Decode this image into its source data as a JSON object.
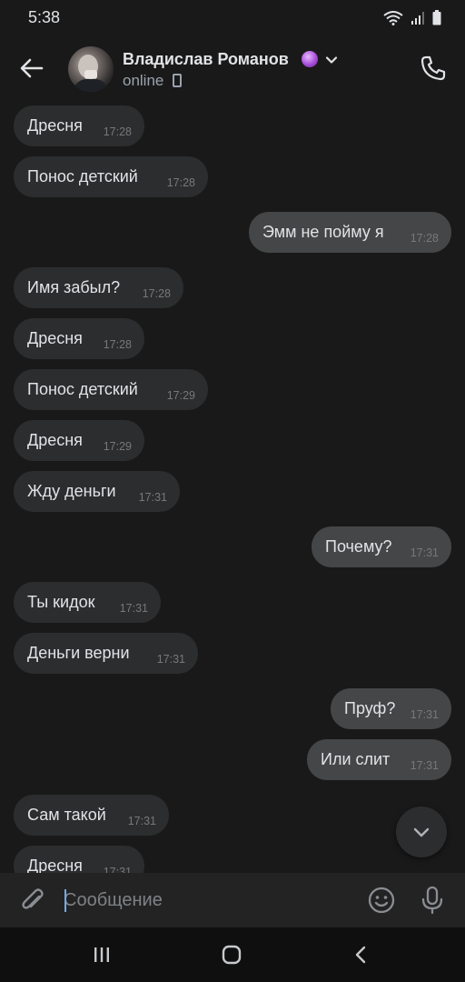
{
  "status_bar": {
    "time": "5:38"
  },
  "header": {
    "contact_name": "Владислав Романов",
    "status": "online"
  },
  "messages": [
    {
      "direction": "in",
      "text": "Дресня",
      "time": "17:28"
    },
    {
      "direction": "in",
      "text": "Понос детский",
      "time": "17:28"
    },
    {
      "direction": "out",
      "text": "Эмм не пойму я",
      "time": "17:28"
    },
    {
      "direction": "in",
      "text": "Имя забыл?",
      "time": "17:28"
    },
    {
      "direction": "in",
      "text": "Дресня",
      "time": "17:28"
    },
    {
      "direction": "in",
      "text": "Понос детский",
      "time": "17:29"
    },
    {
      "direction": "in",
      "text": "Дресня",
      "time": "17:29"
    },
    {
      "direction": "in",
      "text": "Жду деньги",
      "time": "17:31"
    },
    {
      "direction": "out",
      "text": "Почему?",
      "time": "17:31"
    },
    {
      "direction": "in",
      "text": "Ты кидок",
      "time": "17:31"
    },
    {
      "direction": "in",
      "text": "Деньги верни",
      "time": "17:31"
    },
    {
      "direction": "out",
      "text": "Пруф?",
      "time": "17:31"
    },
    {
      "direction": "out",
      "text": "Или слит",
      "time": "17:31"
    },
    {
      "direction": "in",
      "text": "Сам такой",
      "time": "17:31"
    },
    {
      "direction": "in",
      "text": "Дресня",
      "time": "17:31"
    }
  ],
  "composer": {
    "placeholder": "Сообщение"
  },
  "icons": {
    "back": "arrow-left-icon",
    "call": "phone-icon",
    "attach": "paperclip-icon",
    "emoji": "smiley-icon",
    "mic": "microphone-icon",
    "scroll_down": "chevron-down-icon"
  },
  "colors": {
    "background": "#191919",
    "incoming_bubble": "#2c2d2e",
    "outgoing_bubble": "#454647",
    "text": "#e1e3e6",
    "muted": "#99a2ad",
    "accent": "#71aaeb"
  }
}
